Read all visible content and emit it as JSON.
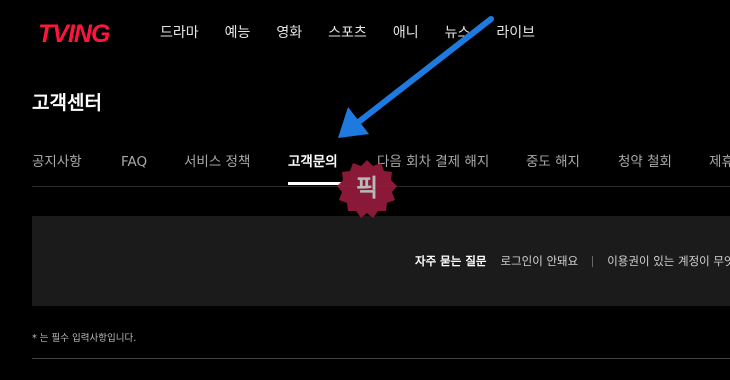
{
  "header": {
    "logo": "TVING",
    "nav": [
      "드라마",
      "예능",
      "영화",
      "스포츠",
      "애니",
      "뉴스",
      "라이브"
    ]
  },
  "page": {
    "title": "고객센터"
  },
  "tabs": [
    {
      "label": "공지사항",
      "active": false
    },
    {
      "label": "FAQ",
      "active": false
    },
    {
      "label": "서비스 정책",
      "active": false
    },
    {
      "label": "고객문의",
      "active": true
    },
    {
      "label": "다음 회차 결제 해지",
      "active": false
    },
    {
      "label": "중도 해지",
      "active": false
    },
    {
      "label": "청약 철회",
      "active": false
    },
    {
      "label": "제휴",
      "active": false
    }
  ],
  "faq": {
    "label": "자주 묻는 질문",
    "links": [
      "로그인이 안돼요",
      "이용권이 있는 계정이 무엇"
    ]
  },
  "form": {
    "required_note": "* 는 필수 입력사항입니다."
  },
  "watermark": {
    "text": "픽"
  },
  "colors": {
    "brand": "#ff153c",
    "background": "#000000",
    "faq_box": "#1b1b1b",
    "annotation_arrow": "#1f7ae0",
    "watermark": "#9c1d3f"
  }
}
